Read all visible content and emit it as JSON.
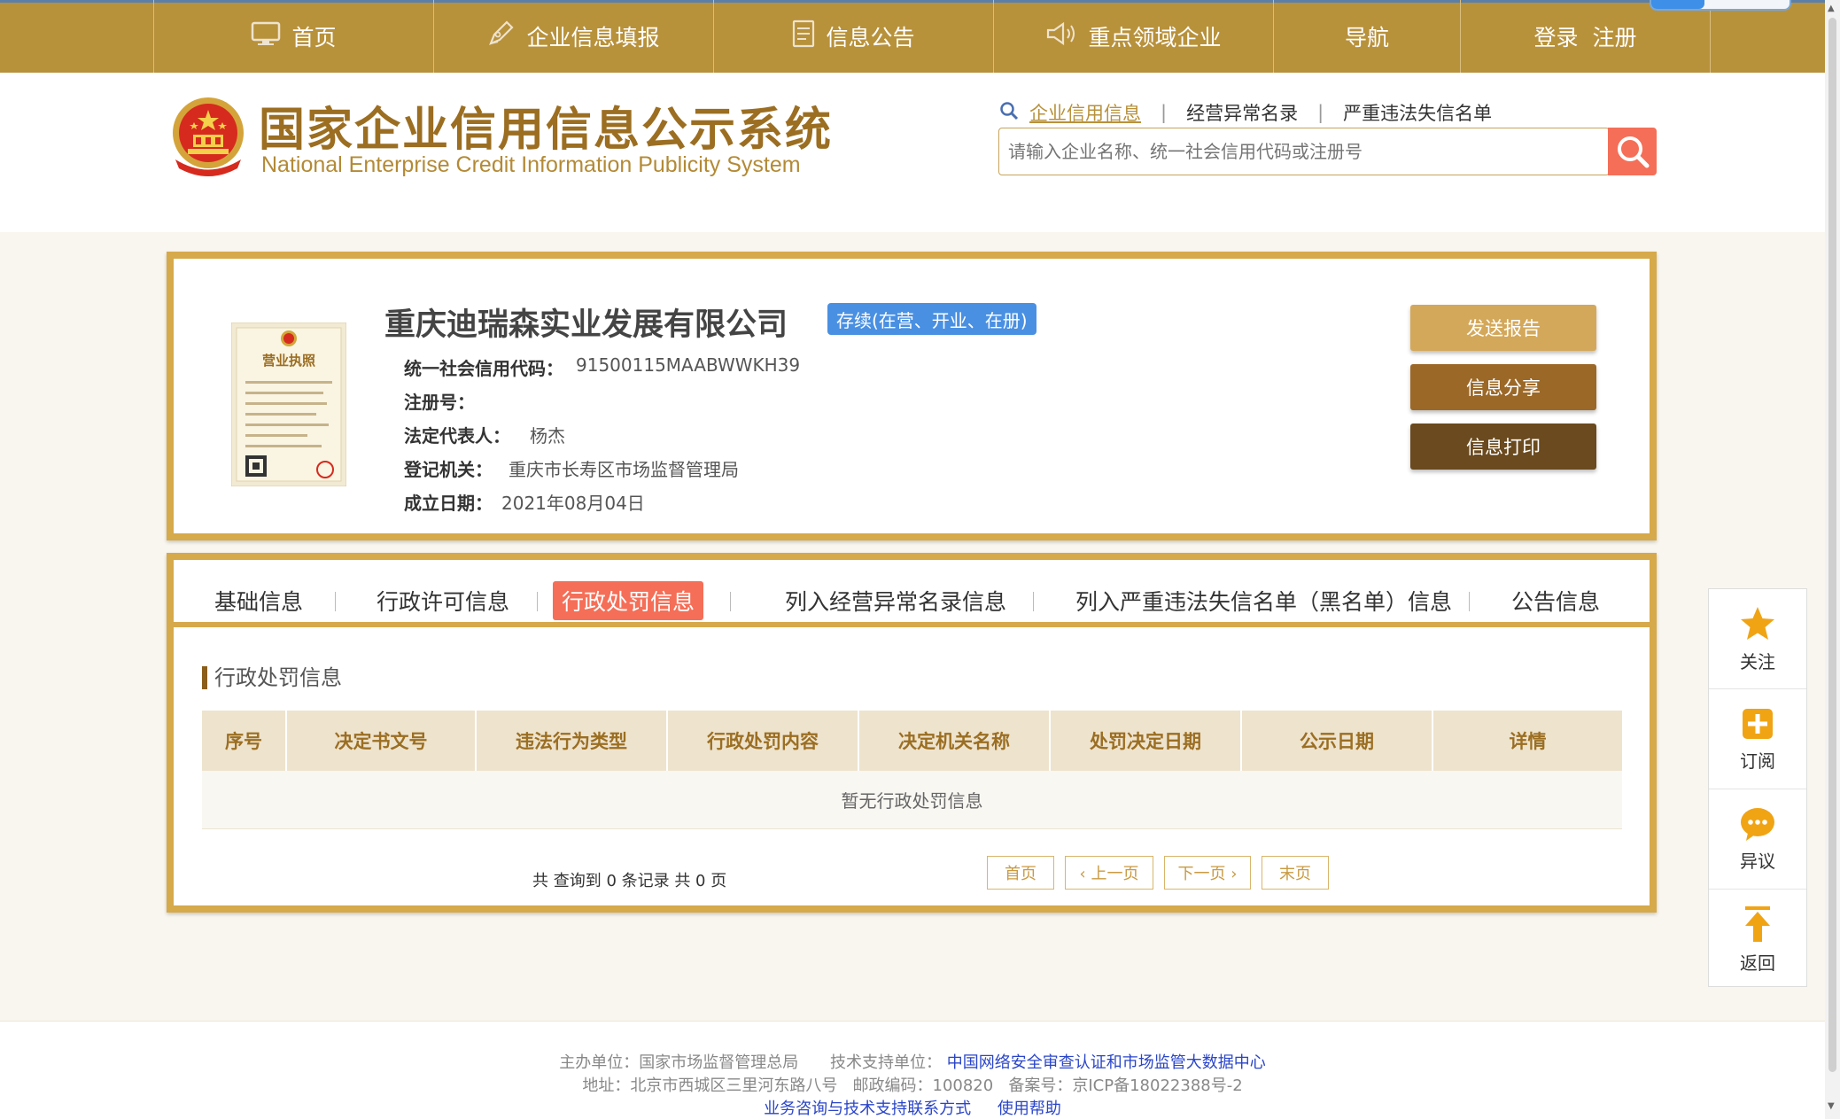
{
  "nav": {
    "items": [
      {
        "label": "首页",
        "icon": "monitor-icon"
      },
      {
        "label": "企业信息填报",
        "icon": "pen-icon"
      },
      {
        "label": "信息公告",
        "icon": "document-icon"
      },
      {
        "label": "重点领域企业",
        "icon": "speaker-icon"
      },
      {
        "label": "导航"
      },
      {
        "label": "登录  注册"
      }
    ]
  },
  "header": {
    "title": "国家企业信用信息公示系统",
    "subtitle": "National Enterprise Credit Information Publicity System",
    "search_tabs": [
      "企业信用信息",
      "经营异常名录",
      "严重违法失信名单"
    ],
    "search_placeholder": "请输入企业名称、统一社会信用代码或注册号"
  },
  "company": {
    "name": "重庆迪瑞森实业发展有限公司",
    "status": "存续(在营、开业、在册)",
    "fields": [
      {
        "label": "统一社会信用代码：",
        "value": "91500115MAABWWKH39"
      },
      {
        "label": "注册号：",
        "value": ""
      },
      {
        "label": "法定代表人：",
        "value": "杨杰"
      },
      {
        "label": "登记机关：",
        "value": "重庆市长寿区市场监督管理局"
      },
      {
        "label": "成立日期：",
        "value": "2021年08月04日"
      }
    ],
    "buttons": [
      "发送报告",
      "信息分享",
      "信息打印"
    ],
    "license_label": "营业执照"
  },
  "tabs": [
    "基础信息",
    "行政许可信息",
    "行政处罚信息",
    "列入经营异常名录信息",
    "列入严重违法失信名单（黑名单）信息",
    "公告信息"
  ],
  "section": {
    "title": "行政处罚信息",
    "columns": [
      "序号",
      "决定书文号",
      "违法行为类型",
      "行政处罚内容",
      "决定机关名称",
      "处罚决定日期",
      "公示日期",
      "详情"
    ],
    "empty_text": "暂无行政处罚信息",
    "pager_summary": "共 查询到 0 条记录 共 0 页",
    "pager_buttons": [
      "首页",
      "‹ 上一页",
      "下一页 ›",
      "末页"
    ]
  },
  "sidefloat": [
    {
      "label": "关注",
      "icon": "star-icon"
    },
    {
      "label": "订阅",
      "icon": "plus-icon"
    },
    {
      "label": "异议",
      "icon": "chat-icon"
    },
    {
      "label": "返回",
      "icon": "arrow-up-icon"
    }
  ],
  "footer": {
    "sponsor_label": "主办单位：国家市场监督管理总局",
    "tech_label": "技术支持单位：",
    "tech_org": "中国网络安全审查认证和市场监管大数据中心",
    "address": "地址：北京市西城区三里河东路八号   邮政编码：100820   备案号：京ICP备18022388号-2",
    "links": [
      "业务咨询与技术支持联系方式",
      "使用帮助"
    ]
  },
  "colors": {
    "brand": "#b8913b",
    "accent": "#f56e57",
    "status_blue": "#4a90e2",
    "border_gold": "#d6a94a"
  }
}
